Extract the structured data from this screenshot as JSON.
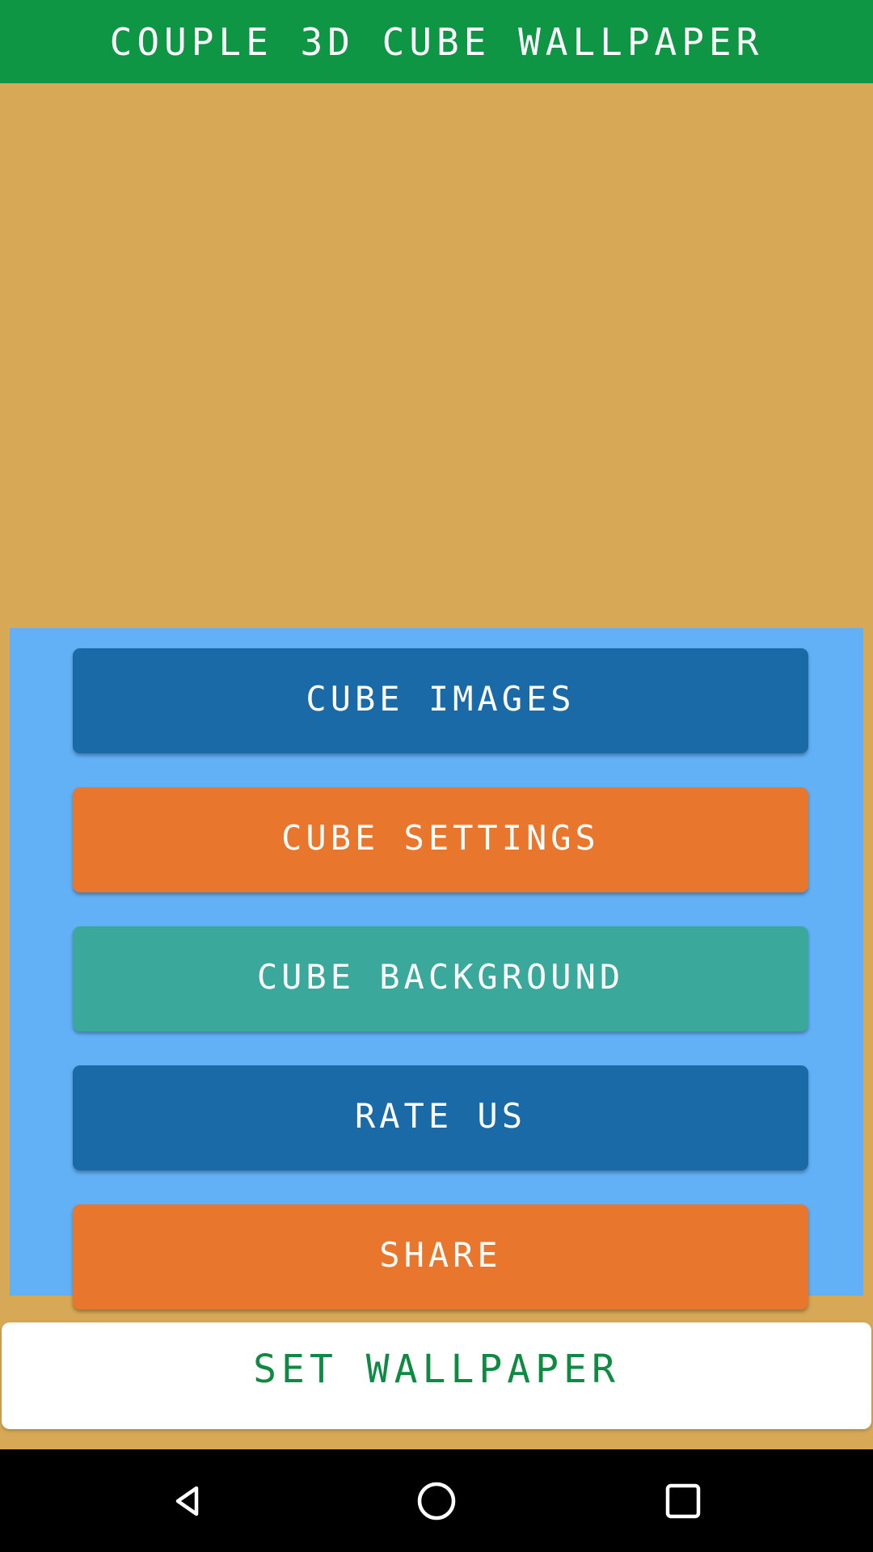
{
  "appbar": {
    "title": "COUPLE 3D CUBE WALLPAPER",
    "background_color": "#0e9644",
    "text_color": "#ffffff"
  },
  "preview": {
    "background_color": "#d7a855"
  },
  "menu_panel": {
    "background_color": "#62b0f6",
    "buttons": [
      {
        "label": "CUBE IMAGES",
        "color": "#1a6aa8",
        "style": "blue"
      },
      {
        "label": "CUBE SETTINGS",
        "color": "#e8762d",
        "style": "orange"
      },
      {
        "label": "CUBE BACKGROUND",
        "color": "#3aa99b",
        "style": "teal"
      },
      {
        "label": "RATE US",
        "color": "#1a6aa8",
        "style": "blue"
      },
      {
        "label": "SHARE",
        "color": "#e8762d",
        "style": "orange"
      }
    ]
  },
  "set_wallpaper": {
    "label": "SET WALLPAPER",
    "text_color": "#0e8a43",
    "background_color": "#ffffff"
  },
  "navbar": {
    "background_color": "#000000",
    "icon_color": "#ffffff",
    "items": [
      {
        "name": "back-icon",
        "label": "Back"
      },
      {
        "name": "home-icon",
        "label": "Home"
      },
      {
        "name": "recents-icon",
        "label": "Recents"
      }
    ]
  }
}
